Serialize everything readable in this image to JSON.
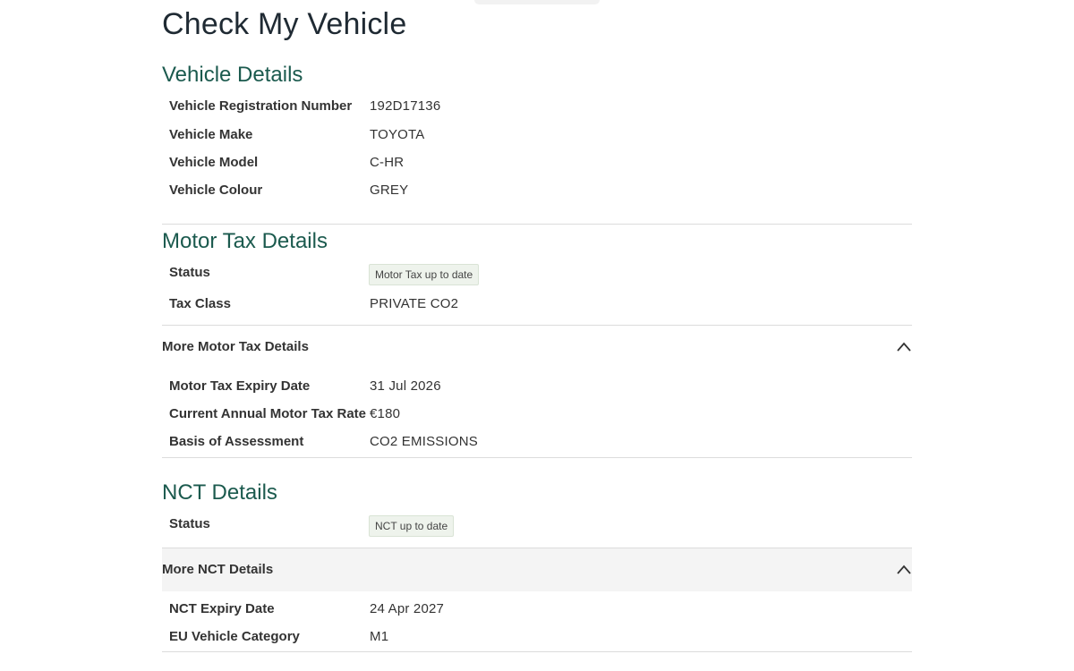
{
  "page": {
    "title": "Check My Vehicle"
  },
  "vehicle_details": {
    "heading": "Vehicle Details",
    "rows": [
      {
        "label": "Vehicle Registration Number",
        "value": "192D17136"
      },
      {
        "label": "Vehicle Make",
        "value": "TOYOTA"
      },
      {
        "label": "Vehicle Model",
        "value": "C-HR"
      },
      {
        "label": "Vehicle Colour",
        "value": "GREY"
      }
    ]
  },
  "motor_tax": {
    "heading": "Motor Tax Details",
    "status_label": "Status",
    "status_badge": "Motor Tax up to date",
    "class_label": "Tax Class",
    "class_value": "PRIVATE CO2",
    "more_label": "More Motor Tax Details",
    "more_rows": [
      {
        "label": "Motor Tax Expiry Date",
        "value": "31 Jul 2026"
      },
      {
        "label": "Current Annual Motor Tax Rate",
        "value": "€180"
      },
      {
        "label": "Basis of Assessment",
        "value": "CO2 EMISSIONS"
      }
    ]
  },
  "nct": {
    "heading": "NCT Details",
    "status_label": "Status",
    "status_badge": "NCT up to date",
    "more_label": "More NCT Details",
    "more_rows": [
      {
        "label": "NCT Expiry Date",
        "value": "24 Apr 2027"
      },
      {
        "label": "EU Vehicle Category",
        "value": "M1"
      }
    ]
  },
  "icons": {
    "accordion_toggle": "chevron-up-icon"
  },
  "colors": {
    "heading": "#1b5a4e",
    "badge_bg": "#eef3ec",
    "accordion_bg": "#f4f4f4"
  }
}
